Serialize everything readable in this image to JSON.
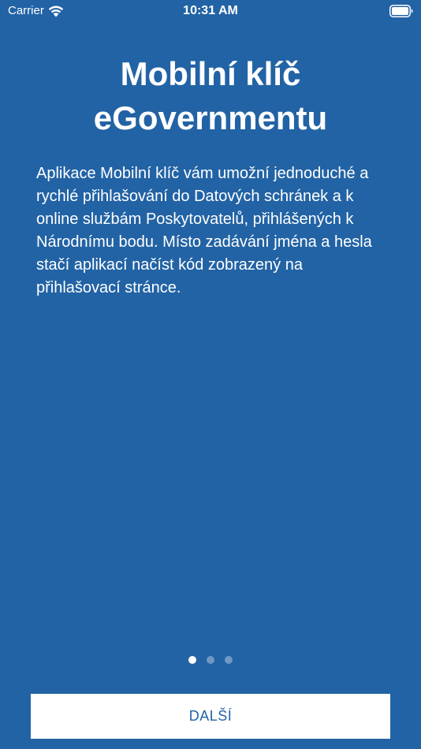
{
  "status_bar": {
    "carrier": "Carrier",
    "time": "10:31 AM",
    "wifi_icon": "wifi-icon",
    "battery_icon": "battery-icon"
  },
  "onboarding": {
    "title_line1": "Mobilní klíč",
    "title_line2": "eGovernmentu",
    "description": "Aplikace Mobilní klíč vám umožní jednoduché a rychlé přihlašování do Datových schránek a k online službám Poskytovatelů, přihlášených k Národnímu bodu. Místo zadávání jména a hesla stačí aplikací načíst kód zobrazený na přihlašovací stránce.",
    "pager": {
      "total_pages": 3,
      "current_page": 1
    },
    "next_label": "DALŠÍ"
  },
  "colors": {
    "background": "#2263a5",
    "button_bg": "#ffffff",
    "button_text": "#2263a5"
  }
}
